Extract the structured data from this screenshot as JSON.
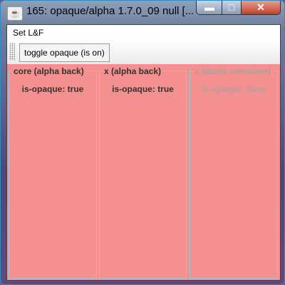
{
  "window": {
    "title": "165: opaque/alpha 1.7.0_09 null  [...",
    "minimize": "▬",
    "maximize": "□",
    "close": "✕"
  },
  "menubar": {
    "items": [
      "Set L&F"
    ]
  },
  "toolbar": {
    "toggle_label": "toggle opaque (is on)"
  },
  "panels": [
    {
      "title": "core (alpha back)",
      "text": "is-opaque: true"
    },
    {
      "title": "x (alpha back)",
      "text": "is-opaque: true"
    },
    {
      "title": "x (alpha container)",
      "text": "is-opaque: false"
    }
  ]
}
